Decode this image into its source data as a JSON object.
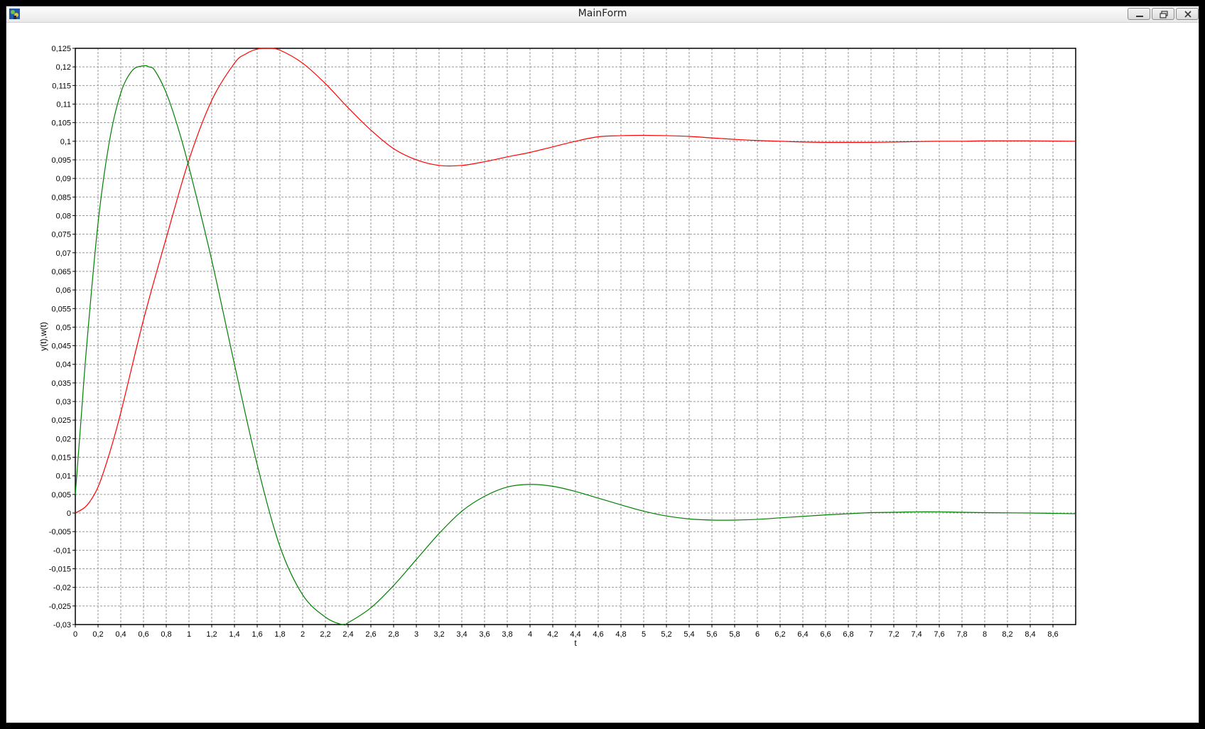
{
  "window": {
    "title": "MainForm",
    "icon": "app-icon",
    "buttons": [
      "minimize-icon",
      "restore-icon",
      "close-icon"
    ]
  },
  "chart_data": {
    "type": "line",
    "xlabel": "t",
    "ylabel": "y(t),w(t)",
    "xlim": [
      0,
      8.8
    ],
    "ylim": [
      -0.03,
      0.125
    ],
    "grid": true,
    "x_ticks": [
      "0",
      "0,2",
      "0,4",
      "0,6",
      "0,8",
      "1",
      "1,2",
      "1,4",
      "1,6",
      "1,8",
      "2",
      "2,2",
      "2,4",
      "2,6",
      "2,8",
      "3",
      "3,2",
      "3,4",
      "3,6",
      "3,8",
      "4",
      "4,2",
      "4,4",
      "4,6",
      "4,8",
      "5",
      "5,2",
      "5,4",
      "5,6",
      "5,8",
      "6",
      "6,2",
      "6,4",
      "6,6",
      "6,8",
      "7",
      "7,2",
      "7,4",
      "7,6",
      "7,8",
      "8",
      "8,2",
      "8,4",
      "8,6"
    ],
    "y_ticks": [
      "-0,03",
      "-0,025",
      "-0,02",
      "-0,015",
      "-0,01",
      "-0,005",
      "0",
      "0,005",
      "0,01",
      "0,015",
      "0,02",
      "0,025",
      "0,03",
      "0,035",
      "0,04",
      "0,045",
      "0,05",
      "0,055",
      "0,06",
      "0,065",
      "0,07",
      "0,075",
      "0,08",
      "0,085",
      "0,09",
      "0,095",
      "0,1",
      "0,105",
      "0,11",
      "0,115",
      "0,12",
      "0,125"
    ],
    "series": [
      {
        "color": "#ff0000",
        "x": [
          0,
          0.1,
          0.2,
          0.3,
          0.4,
          0.6,
          0.8,
          1.0,
          1.2,
          1.4,
          1.5,
          1.6,
          1.7,
          1.8,
          2.0,
          2.2,
          2.4,
          2.6,
          2.8,
          3.0,
          3.2,
          3.4,
          3.6,
          3.8,
          4.0,
          4.2,
          4.4,
          4.6,
          4.8,
          5.0,
          5.2,
          5.4,
          5.6,
          5.8,
          6.0,
          6.2,
          6.4,
          6.6,
          6.8,
          7.0,
          7.2,
          7.4,
          7.6,
          7.8,
          8.0,
          8.4,
          8.8
        ],
        "y": [
          0,
          0.002,
          0.007,
          0.016,
          0.027,
          0.052,
          0.074,
          0.095,
          0.111,
          0.121,
          0.1235,
          0.1248,
          0.125,
          0.1245,
          0.121,
          0.1155,
          0.109,
          0.103,
          0.098,
          0.095,
          0.0935,
          0.0935,
          0.0945,
          0.0958,
          0.097,
          0.0985,
          0.1,
          0.1012,
          0.1015,
          0.1016,
          0.1015,
          0.1013,
          0.1009,
          0.1005,
          0.1002,
          0.1,
          0.0998,
          0.0997,
          0.0997,
          0.0997,
          0.0998,
          0.0999,
          0.1,
          0.1,
          0.1001,
          0.1001,
          0.1
        ]
      },
      {
        "color": "#008000",
        "x": [
          0,
          0.05,
          0.1,
          0.2,
          0.3,
          0.4,
          0.5,
          0.6,
          0.65,
          0.7,
          0.8,
          0.9,
          1.0,
          1.2,
          1.4,
          1.6,
          1.8,
          2.0,
          2.2,
          2.35,
          2.4,
          2.6,
          2.8,
          3.0,
          3.2,
          3.4,
          3.6,
          3.8,
          4.0,
          4.2,
          4.4,
          4.6,
          4.8,
          5.0,
          5.2,
          5.4,
          5.6,
          5.8,
          6.0,
          6.2,
          6.4,
          6.6,
          6.8,
          7.0,
          7.2,
          7.4,
          7.6,
          7.8,
          8.0,
          8.4,
          8.8
        ],
        "y": [
          0.005,
          0.025,
          0.045,
          0.078,
          0.1,
          0.113,
          0.119,
          0.1203,
          0.12,
          0.119,
          0.113,
          0.104,
          0.093,
          0.068,
          0.04,
          0.013,
          -0.009,
          -0.022,
          -0.028,
          -0.03,
          -0.0295,
          -0.0255,
          -0.0195,
          -0.0125,
          -0.0055,
          0.0005,
          0.0045,
          0.007,
          0.0077,
          0.0072,
          0.0058,
          0.004,
          0.0022,
          0.0005,
          -0.0008,
          -0.0016,
          -0.0019,
          -0.0019,
          -0.0017,
          -0.0013,
          -0.0009,
          -0.0005,
          -0.0002,
          0.0001,
          0.0002,
          0.0003,
          0.0003,
          0.0002,
          0.0001,
          0,
          -0.0002
        ]
      }
    ]
  }
}
